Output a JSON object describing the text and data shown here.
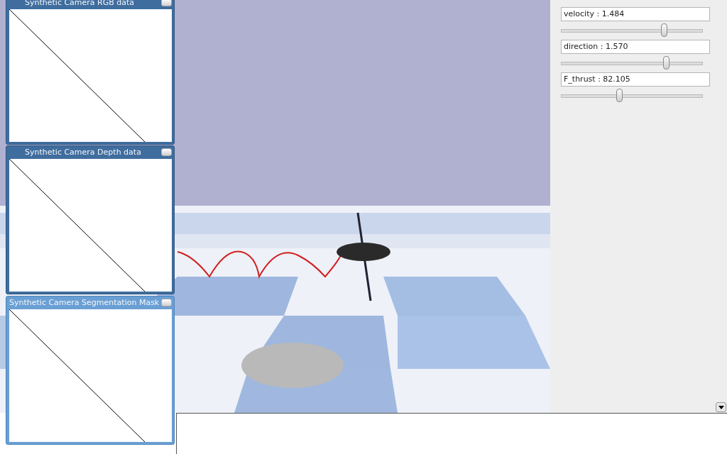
{
  "camera_windows": [
    {
      "title": "Synthetic Camera RGB data",
      "active": false
    },
    {
      "title": "Synthetic Camera Depth data",
      "active": false
    },
    {
      "title": "Synthetic Camera Segmentation Mask",
      "active": true
    }
  ],
  "parameters": [
    {
      "label": "velocity : 1.484",
      "level": 0.73
    },
    {
      "label": "direction : 1.570",
      "level": 0.745
    },
    {
      "label": "F_thrust : 82.105",
      "level": 0.415
    }
  ]
}
